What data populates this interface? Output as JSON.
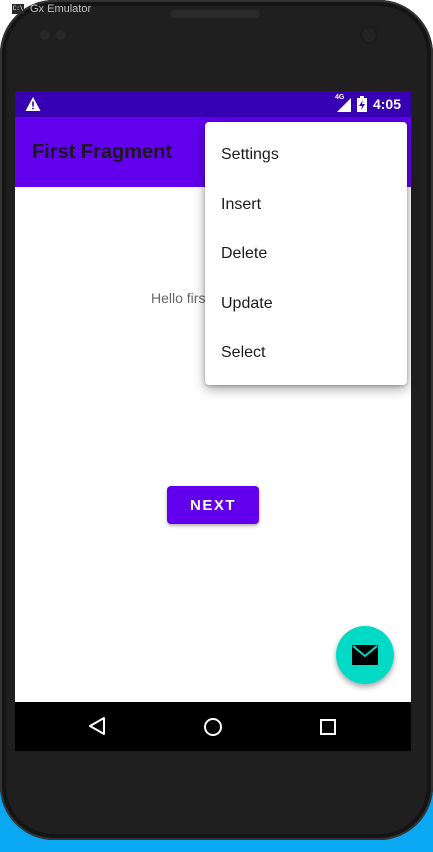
{
  "window": {
    "title": "Gx Emulator"
  },
  "status_bar": {
    "network": "4G",
    "time": "4:05"
  },
  "app_bar": {
    "title": "First Fragment"
  },
  "content": {
    "hello_text": "Hello firs",
    "next_button": "NEXT"
  },
  "overflow_menu": {
    "items": [
      {
        "label": "Settings"
      },
      {
        "label": "Insert"
      },
      {
        "label": "Delete"
      },
      {
        "label": "Update"
      },
      {
        "label": "Select"
      }
    ]
  },
  "colors": {
    "primary": "#6200ee",
    "primary_dark": "#3700b3",
    "accent": "#03dac5"
  },
  "icons": {
    "status_warning": "warning-icon",
    "signal": "signal-icon",
    "battery": "battery-charging-icon",
    "fab": "email-icon",
    "nav_back": "back-icon",
    "nav_home": "home-icon",
    "nav_recents": "recents-icon"
  }
}
